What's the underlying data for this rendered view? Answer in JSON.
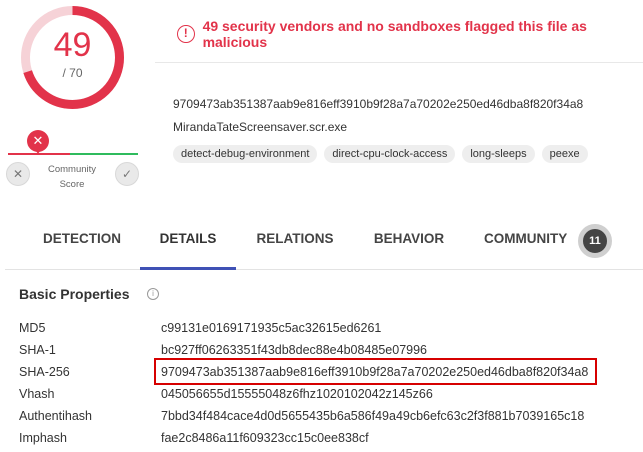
{
  "score": {
    "detected": "49",
    "total": "/ 70",
    "detected_count": 49,
    "total_count": 70,
    "ring_color": "#e2334a"
  },
  "community": {
    "label_line1": "Community",
    "label_line2": "Score",
    "marker_icon": "x-icon",
    "downvote_icon": "x-icon",
    "upvote_icon": "check-icon"
  },
  "alert": {
    "text": "49 security vendors and no sandboxes flagged this file as malicious",
    "icon": "exclamation-circle-icon",
    "color": "#e2334a"
  },
  "file": {
    "hash": "9709473ab351387aab9e816eff3910b9f28a7a70202e250ed46dba8f820f34a8",
    "name": "MirandaTateScreensaver.scr.exe",
    "tags": [
      "detect-debug-environment",
      "direct-cpu-clock-access",
      "long-sleeps",
      "peexe"
    ]
  },
  "tabs": {
    "detection": "DETECTION",
    "details": "DETAILS",
    "relations": "RELATIONS",
    "behavior": "BEHAVIOR",
    "community": "COMMUNITY",
    "community_count": "11",
    "active": "DETAILS"
  },
  "basic_properties": {
    "title": "Basic Properties",
    "info_icon": "info-circle-icon",
    "rows": [
      {
        "label": "MD5",
        "value": "c99131e0169171935c5ac32615ed6261"
      },
      {
        "label": "SHA-1",
        "value": "bc927ff06263351f43db8dec88e4b08485e07996"
      },
      {
        "label": "SHA-256",
        "value": "9709473ab351387aab9e816eff3910b9f28a7a70202e250ed46dba8f820f34a8"
      },
      {
        "label": "Vhash",
        "value": "045056655d15555048z6fhz1020102042z145z66"
      },
      {
        "label": "Authentihash",
        "value": "7bbd34f484cace4d0d5655435b6a586f49a49cb6efc63c2f3f881b7039165c18"
      },
      {
        "label": "Imphash",
        "value": "fae2c8486a11f609323cc15c0ee838cf"
      }
    ]
  },
  "highlight_color": "#d60000"
}
